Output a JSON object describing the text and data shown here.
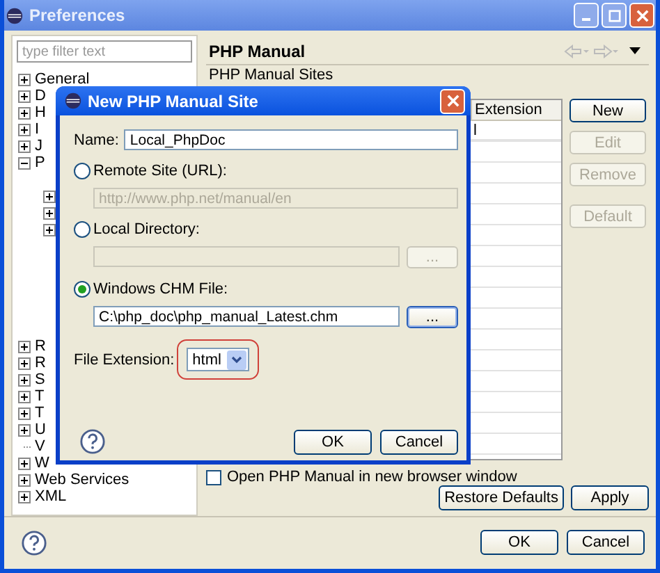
{
  "window": {
    "title": "Preferences"
  },
  "filter": {
    "placeholder": "type filter text"
  },
  "tree": [
    {
      "label": "General",
      "expanded": false
    },
    {
      "label": "D",
      "expanded": false
    },
    {
      "label": "H",
      "expanded": false
    },
    {
      "label": "I",
      "expanded": false
    },
    {
      "label": "J",
      "expanded": false
    },
    {
      "label": "P",
      "expanded": true,
      "children": [
        {
          "expanded": false
        },
        {
          "expanded": false
        },
        {
          "expanded": false
        }
      ]
    },
    {
      "label": "R",
      "expanded": false
    },
    {
      "label": "R",
      "expanded": false
    },
    {
      "label": "S",
      "expanded": false
    },
    {
      "label": "T",
      "expanded": false
    },
    {
      "label": "T",
      "expanded": false
    },
    {
      "label": "U",
      "expanded": false
    },
    {
      "label": "V"
    },
    {
      "label": "W",
      "expanded": false
    },
    {
      "label": "Web Services",
      "expanded": false
    },
    {
      "label": "XML",
      "expanded": false
    }
  ],
  "page": {
    "title": "PHP Manual",
    "sites_label": "PHP Manual Sites",
    "table": {
      "columns": [
        "Extension"
      ],
      "rows": [
        [
          "l"
        ]
      ]
    },
    "side_buttons": [
      {
        "label": "New",
        "disabled": false
      },
      {
        "label": "Edit",
        "disabled": true
      },
      {
        "label": "Remove",
        "disabled": true
      },
      {
        "label": "Default",
        "disabled": true
      }
    ],
    "checkbox": {
      "label": "Open PHP Manual in new browser window",
      "checked": false
    },
    "buttons": [
      "Restore Defaults",
      "Apply"
    ]
  },
  "footer": {
    "buttons": [
      "OK",
      "Cancel"
    ]
  },
  "dialog": {
    "title": "New PHP Manual Site",
    "name": {
      "label": "Name:",
      "value": "Local_PhpDoc"
    },
    "options": [
      {
        "label": "Remote Site (URL):",
        "selected": false,
        "value": "http://www.php.net/manual/en"
      },
      {
        "label": "Local Directory:",
        "selected": false,
        "browse_label": "..."
      },
      {
        "label": "Windows CHM File:",
        "selected": true,
        "value": "C:\\php_doc\\php_manual_Latest.chm",
        "browse_label": "..."
      }
    ],
    "extension": {
      "label": "File Extension:",
      "value": "html",
      "highlighted": true
    },
    "buttons": [
      "OK",
      "Cancel"
    ]
  }
}
